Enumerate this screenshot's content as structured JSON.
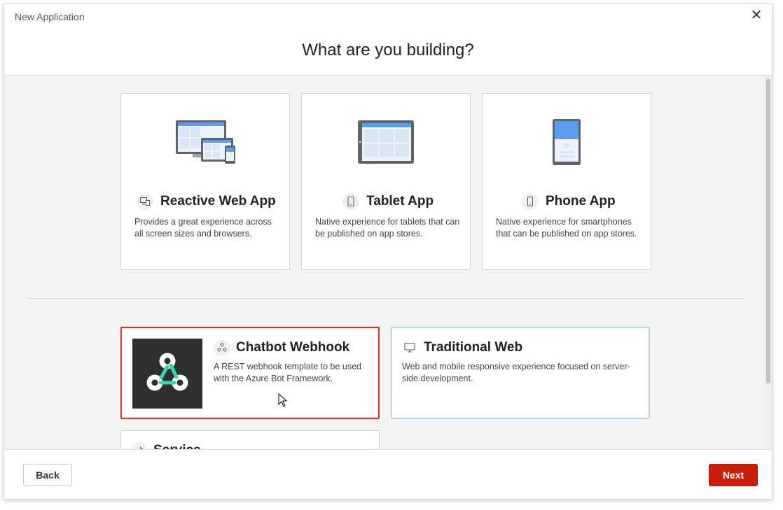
{
  "window": {
    "title": "New Application"
  },
  "heading": "What are you building?",
  "app_types": [
    {
      "title": "Reactive Web App",
      "description": "Provides a great experience across all screen sizes and browsers.",
      "icon": "devices-icon"
    },
    {
      "title": "Tablet App",
      "description": "Native experience for tablets that can be published on app stores.",
      "icon": "tablet-icon"
    },
    {
      "title": "Phone App",
      "description": "Native experience for smartphones that can be published on app stores.",
      "icon": "phone-icon"
    }
  ],
  "other_types": [
    {
      "title": "Chatbot Webhook",
      "description": "A REST webhook template to be used with the Azure Bot Framework.",
      "icon": "webhook-icon",
      "selected": true
    },
    {
      "title": "Traditional Web",
      "description": "Web and mobile responsive experience focused on server-side development.",
      "icon": "monitor-icon",
      "selected": false
    },
    {
      "title": "Service",
      "description": "",
      "icon": "service-icon",
      "selected": false
    }
  ],
  "buttons": {
    "back": "Back",
    "next": "Next"
  },
  "colors": {
    "accent": "#c81e0a",
    "selected_border": "#d6321f",
    "hover_border": "#b6d4f2",
    "illustration_blue": "#5b9cf0"
  }
}
